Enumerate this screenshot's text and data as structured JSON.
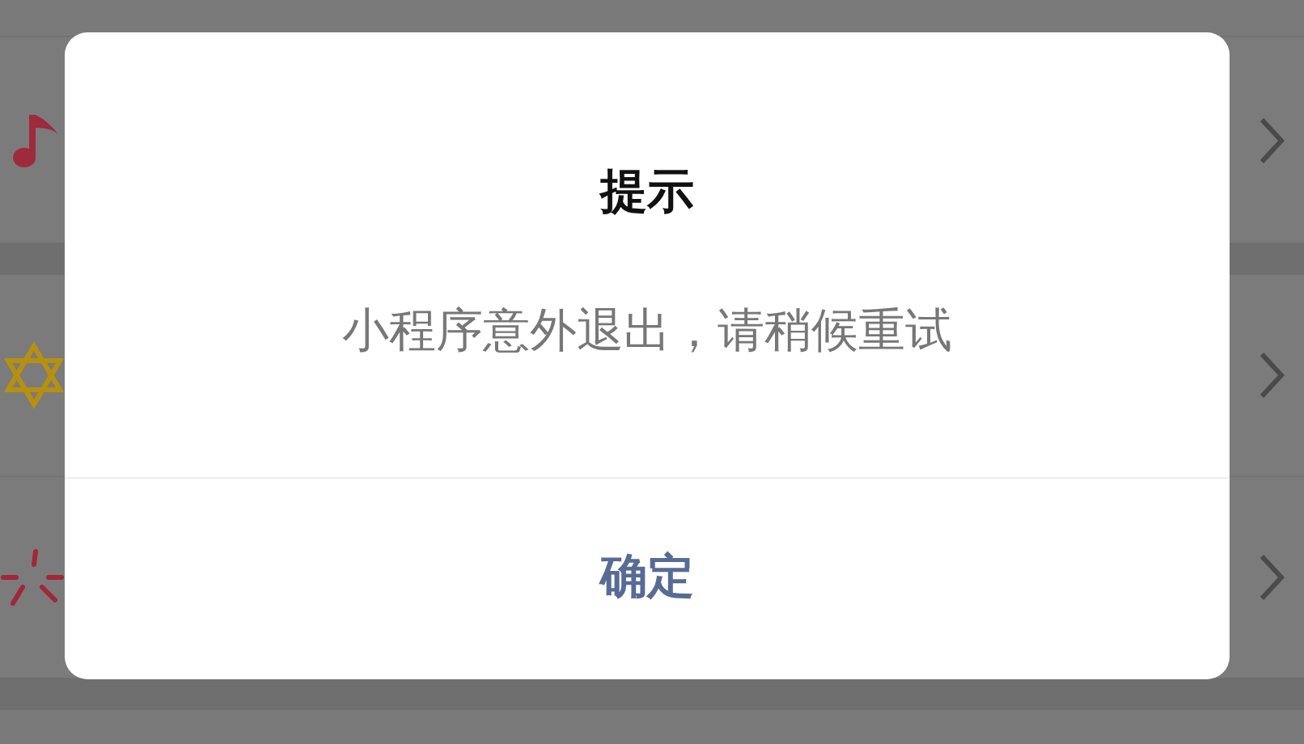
{
  "dialog": {
    "title": "提示",
    "message": "小程序意外退出，请稍候重试",
    "button": "确定"
  }
}
